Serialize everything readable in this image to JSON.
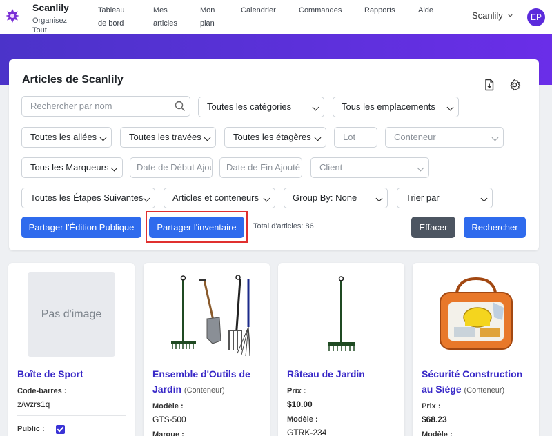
{
  "nav": {
    "brand": "Scanlily",
    "tagline": "Organisez Tout",
    "links": [
      {
        "label": "Tableau de bord"
      },
      {
        "label": "Mes articles"
      },
      {
        "label": "Mon plan"
      },
      {
        "label": "Calendrier"
      },
      {
        "label": "Commandes"
      },
      {
        "label": "Rapports"
      },
      {
        "label": "Aide"
      }
    ],
    "account": "Scanlily",
    "avatar_initials": "EP"
  },
  "panel": {
    "title": "Articles de Scanlily",
    "search_placeholder": "Rechercher par nom",
    "categories": "Toutes les catégories",
    "locations": "Tous les emplacements",
    "aisles": "Toutes les allées",
    "bays": "Toutes les travées",
    "shelves": "Toutes les étagères",
    "lot_placeholder": "Lot",
    "container_placeholder": "Conteneur",
    "markers": "Tous les Marqueurs",
    "start_date_placeholder": "Date de Début Ajouté",
    "end_date_placeholder": "Date de Fin Ajouté",
    "client_placeholder": "Client",
    "next_steps": "Toutes les Étapes Suivantes",
    "item_type": "Articles et conteneurs",
    "group_by": "Group By: None",
    "sort_by": "Trier par",
    "share_public_edit": "Partager l'Édition Publique",
    "share_inventory": "Partager l'inventaire",
    "total": "Total d'articles: 86",
    "clear": "Effacer",
    "search": "Rechercher"
  },
  "cards": [
    {
      "no_image": "Pas d'image",
      "title": "Boîte de Sport",
      "barcode_label": "Code-barres :",
      "barcode": "z/wzrs1q",
      "public_label": "Public :"
    },
    {
      "title": "Ensemble d'Outils de Jardin",
      "subtitle": "(Conteneur)",
      "model_label": "Modèle :",
      "model": "GTS-500",
      "brand_label": "Marque :"
    },
    {
      "title": "Râteau de Jardin",
      "price_label": "Prix :",
      "price": "$10.00",
      "model_label": "Modèle :",
      "model": "GTRK-234"
    },
    {
      "title": "Sécurité Construction au Siège",
      "subtitle": "(Conteneur)",
      "price_label": "Prix :",
      "price": "$68.23",
      "model_label": "Modèle :"
    }
  ],
  "colors": {
    "accent": "#2f6bed",
    "link": "#3828c7",
    "hero_start": "#4b33c9",
    "hero_end": "#6a2ee8",
    "highlight": "#e0302f"
  }
}
